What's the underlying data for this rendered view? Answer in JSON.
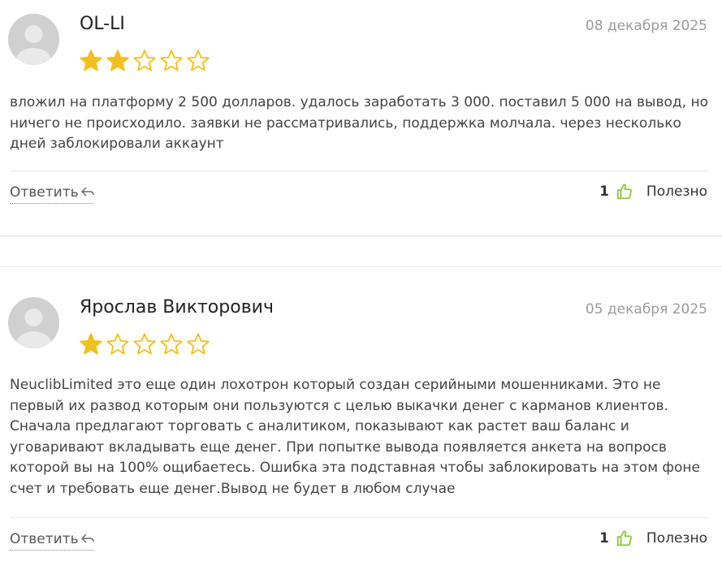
{
  "colors": {
    "star_filled": "#f2c01e",
    "star_outline": "#f2c01e",
    "thumb": "#8cc63f",
    "date": "#9a9a9a"
  },
  "reviews": [
    {
      "author": "OL-LI",
      "date": "08 декабря 2025",
      "rating": 2,
      "rating_max": 5,
      "text": "вложил на платформу 2 500 долларов. удалось заработать 3 000. поставил 5 000 на вывод, но ничего не происходило. заявки не рассматривались, поддержка молчала. через несколько дней заблокировали аккаунт",
      "reply_label": "Ответить",
      "useful_count": "1",
      "useful_label": "Полезно"
    },
    {
      "author": "Ярослав Викторович",
      "date": "05 декабря 2025",
      "rating": 1,
      "rating_max": 5,
      "text": "NeuclibLimited это еще один лохотрон который создан серийными мошенниками. Это не первый их развод которым они пользуются с целью выкачки денег с карманов клиентов. Сначала предлагают торговать с аналитиком, показывают как растет ваш баланс и уговаривают вкладывать еще денег. При попытке вывода появляется анкета на вопросв которой вы на 100% ощибаетесь. Ошибка эта подставная чтобы заблокировать на этом фоне счет и требовать еще денег.Вывод не будет в любом случае",
      "reply_label": "Ответить",
      "useful_count": "1",
      "useful_label": "Полезно"
    }
  ]
}
